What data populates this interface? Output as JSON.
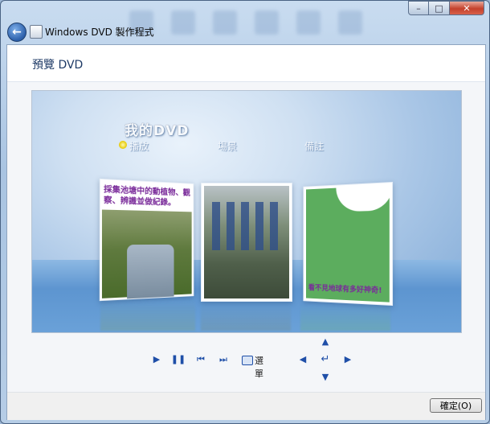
{
  "window": {
    "title": "Windows DVD 製作程式",
    "caption": {
      "minimize": "–",
      "maximize": "□",
      "close": "✕"
    }
  },
  "nav": {
    "back_icon": "back-arrow-icon"
  },
  "page": {
    "title": "預覽 DVD"
  },
  "dvd_menu": {
    "title": "我的DVD",
    "items": [
      "播放",
      "場景",
      "備註"
    ],
    "panel1_caption": "採集池塘中的動植物、觀察、辨識並做紀錄。",
    "panel3_caption": "看不見地球有多好神奇!"
  },
  "controls": {
    "menu_label": "選單"
  },
  "footer": {
    "ok_label": "確定(O)"
  }
}
